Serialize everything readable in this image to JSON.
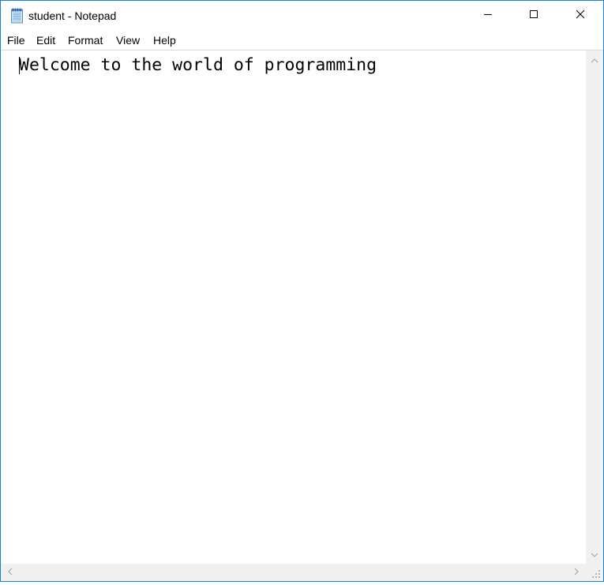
{
  "window": {
    "title": "student - Notepad",
    "icon": "notepad-icon",
    "controls": {
      "minimize_icon": "minimize-icon",
      "maximize_icon": "maximize-icon",
      "close_icon": "close-icon"
    }
  },
  "menu": {
    "file": "File",
    "edit": "Edit",
    "format": "Format",
    "view": "View",
    "help": "Help"
  },
  "editor": {
    "text": "Welcome to the world of programming"
  },
  "colors": {
    "window_border": "#1883d7",
    "scrollbar_track": "#f0f0f0",
    "scroll_arrow": "#a6a6a6"
  }
}
